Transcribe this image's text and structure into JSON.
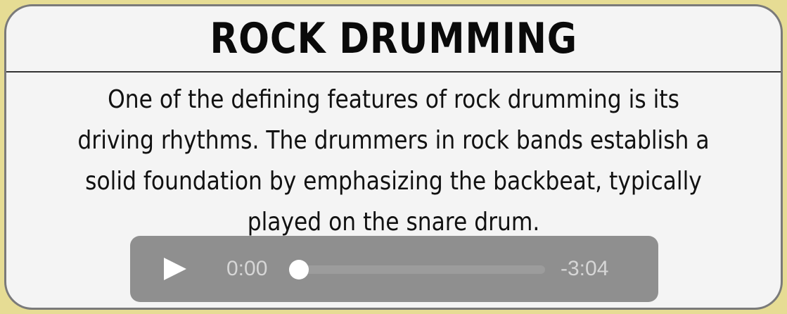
{
  "card": {
    "title": "ROCK DRUMMING",
    "body_lines": [
      "One of the defining features of rock drumming is its",
      "driving rhythms. The drummers in rock bands establish a",
      "solid foundation by emphasizing the backbeat, typically",
      "played on the snare drum."
    ]
  },
  "player": {
    "play_icon": "play-icon",
    "current_time": "0:00",
    "remaining_time": "-3:04",
    "progress": 0
  },
  "colors": {
    "background": "#e6dc94",
    "card": "#f4f4f4",
    "player": "#8f8f8f"
  }
}
